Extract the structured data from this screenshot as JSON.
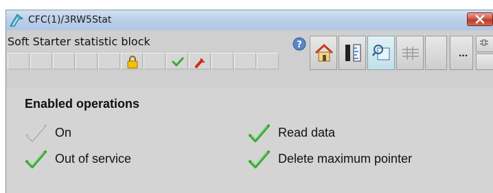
{
  "window": {
    "title": "CFC(1)/3RW5Stat",
    "icons": {
      "app": "block-editor-icon",
      "close": "close-icon"
    }
  },
  "block": {
    "title": "Soft Starter statistic block",
    "status_strip": {
      "icons": [
        "lock-icon",
        "enabled-check-icon",
        "wrench-icon"
      ]
    },
    "toolbar": {
      "icons": [
        "help-icon",
        "home-icon",
        "ruler-scale-icon",
        "faceplate-zoom-icon",
        "network-icon"
      ],
      "more_label": "...",
      "small_icons": [
        "block-connect-icon"
      ]
    }
  },
  "operations": {
    "heading": "Enabled operations",
    "items": [
      {
        "label": "On",
        "enabled": false,
        "icon": "check-icon"
      },
      {
        "label": "Read data",
        "enabled": true,
        "icon": "check-icon"
      },
      {
        "label": "Out of service",
        "enabled": true,
        "icon": "check-icon"
      },
      {
        "label": "Delete maximum pointer",
        "enabled": true,
        "icon": "check-icon"
      }
    ]
  },
  "colors": {
    "check_enabled": "#36a82c",
    "check_disabled": "#bdbdbd",
    "panel_bg": "#d4d4d4",
    "titlebar": "#bcd0ea"
  }
}
